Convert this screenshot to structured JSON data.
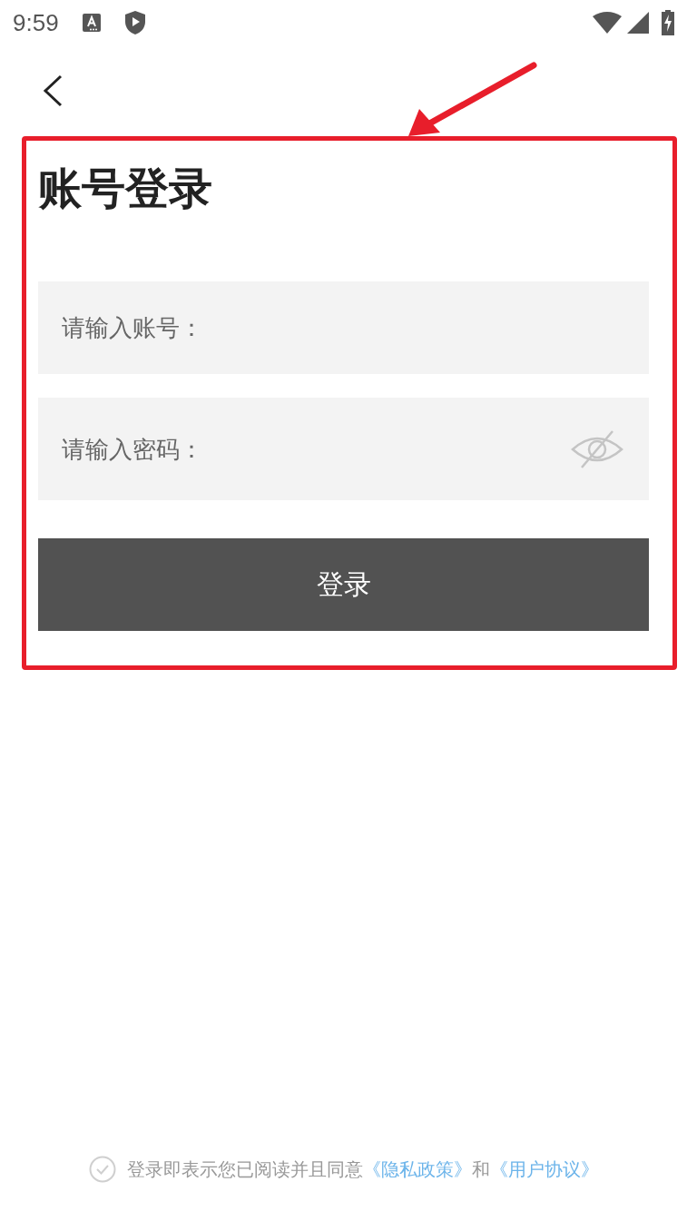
{
  "status_bar": {
    "time": "9:59"
  },
  "title": "账号登录",
  "fields": [
    {
      "kind": "text",
      "placeholder": "请输入账号："
    },
    {
      "kind": "password",
      "placeholder": "请输入密码：",
      "password_visible": false
    }
  ],
  "login_button": "登录",
  "agreement": {
    "checked": false,
    "text": "登录即表示您已阅读并且同意",
    "links": [
      "《隐私政策》",
      "《用户协议》"
    ],
    "joiner": "和"
  }
}
